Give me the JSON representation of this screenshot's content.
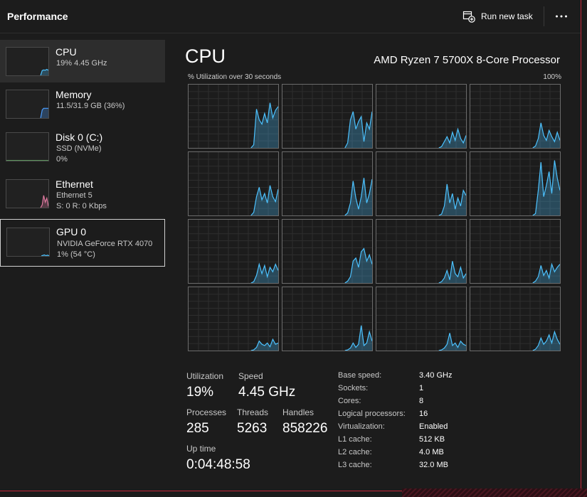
{
  "header": {
    "title": "Performance",
    "run_new_task": "Run new task",
    "run_icon": "run-task-icon",
    "more_icon": "more-options-icon"
  },
  "sidebar": {
    "items": [
      {
        "name": "CPU",
        "line1": "19%  4.45 GHz",
        "line2": "",
        "active": true,
        "color": "#4cc2ff"
      },
      {
        "name": "Memory",
        "line1": "11.5/31.9 GB (36%)",
        "line2": "",
        "active": false,
        "color": "#4a9eff"
      },
      {
        "name": "Disk 0 (C:)",
        "line1": "SSD (NVMe)",
        "line2": "0%",
        "active": false,
        "color": "#7fd87f"
      },
      {
        "name": "Ethernet",
        "line1": "Ethernet 5",
        "line2": "S: 0  R: 0 Kbps",
        "active": false,
        "color": "#e07aa0"
      },
      {
        "name": "GPU 0",
        "line1": "NVIDIA GeForce RTX 4070",
        "line2": "1%  (54 °C)",
        "active": false,
        "color": "#4cc2ff"
      }
    ]
  },
  "main": {
    "title": "CPU",
    "model": "AMD Ryzen 7 5700X 8-Core Processor",
    "graph_caption": "% Utilization over 30 seconds",
    "graph_max": "100%",
    "graph_color": "#4cc2ff",
    "stats": {
      "utilization_label": "Utilization",
      "utilization_value": "19%",
      "speed_label": "Speed",
      "speed_value": "4.45 GHz",
      "processes_label": "Processes",
      "processes_value": "285",
      "threads_label": "Threads",
      "threads_value": "5263",
      "handles_label": "Handles",
      "handles_value": "858226",
      "uptime_label": "Up time",
      "uptime_value": "0:04:48:58"
    },
    "specs": [
      {
        "label": "Base speed:",
        "value": "3.40 GHz"
      },
      {
        "label": "Sockets:",
        "value": "1"
      },
      {
        "label": "Cores:",
        "value": "8"
      },
      {
        "label": "Logical processors:",
        "value": "16"
      },
      {
        "label": "Virtualization:",
        "value": "Enabled"
      },
      {
        "label": "L1 cache:",
        "value": "512 KB"
      },
      {
        "label": "L2 cache:",
        "value": "4.0 MB"
      },
      {
        "label": "L3 cache:",
        "value": "32.0 MB"
      }
    ]
  },
  "chart_data": {
    "type": "area",
    "ylim": [
      0,
      100
    ],
    "grid": true,
    "series": [
      {
        "values": [
          0,
          0,
          0,
          0,
          0,
          0,
          0,
          0,
          0,
          0,
          0,
          0,
          0,
          0,
          0,
          0,
          0,
          0,
          0,
          0,
          0,
          0,
          0,
          0,
          5,
          62,
          45,
          38,
          55,
          40,
          72,
          48,
          60,
          66
        ]
      },
      {
        "values": [
          0,
          0,
          0,
          0,
          0,
          0,
          0,
          0,
          0,
          0,
          0,
          0,
          0,
          0,
          0,
          0,
          0,
          0,
          0,
          0,
          0,
          0,
          0,
          0,
          8,
          45,
          58,
          30,
          42,
          50,
          10,
          40,
          30,
          58
        ]
      },
      {
        "values": [
          0,
          0,
          0,
          0,
          0,
          0,
          0,
          0,
          0,
          0,
          0,
          0,
          0,
          0,
          0,
          0,
          0,
          0,
          0,
          0,
          0,
          0,
          0,
          0,
          2,
          10,
          18,
          8,
          25,
          12,
          30,
          15,
          8,
          20
        ]
      },
      {
        "values": [
          0,
          0,
          0,
          0,
          0,
          0,
          0,
          0,
          0,
          0,
          0,
          0,
          0,
          0,
          0,
          0,
          0,
          0,
          0,
          0,
          0,
          0,
          0,
          0,
          3,
          15,
          40,
          20,
          12,
          28,
          18,
          10,
          25,
          12
        ]
      },
      {
        "values": [
          0,
          0,
          0,
          0,
          0,
          0,
          0,
          0,
          0,
          0,
          0,
          0,
          0,
          0,
          0,
          0,
          0,
          0,
          0,
          0,
          0,
          0,
          0,
          0,
          5,
          30,
          45,
          25,
          35,
          20,
          48,
          30,
          22,
          42
        ]
      },
      {
        "values": [
          0,
          0,
          0,
          0,
          0,
          0,
          0,
          0,
          0,
          0,
          0,
          0,
          0,
          0,
          0,
          0,
          0,
          0,
          0,
          0,
          0,
          0,
          0,
          0,
          4,
          20,
          55,
          28,
          10,
          30,
          60,
          20,
          35,
          58
        ]
      },
      {
        "values": [
          0,
          0,
          0,
          0,
          0,
          0,
          0,
          0,
          0,
          0,
          0,
          0,
          0,
          0,
          0,
          0,
          0,
          0,
          0,
          0,
          0,
          0,
          0,
          0,
          2,
          15,
          50,
          20,
          35,
          10,
          28,
          15,
          40,
          32
        ]
      },
      {
        "values": [
          0,
          0,
          0,
          0,
          0,
          0,
          0,
          0,
          0,
          0,
          0,
          0,
          0,
          0,
          0,
          0,
          0,
          0,
          0,
          0,
          0,
          0,
          0,
          0,
          3,
          40,
          85,
          30,
          48,
          70,
          35,
          88,
          60,
          40
        ]
      },
      {
        "values": [
          0,
          0,
          0,
          0,
          0,
          0,
          0,
          0,
          0,
          0,
          0,
          0,
          0,
          0,
          0,
          0,
          0,
          0,
          0,
          0,
          0,
          0,
          0,
          0,
          2,
          12,
          30,
          15,
          28,
          10,
          25,
          18,
          30,
          20
        ]
      },
      {
        "values": [
          0,
          0,
          0,
          0,
          0,
          0,
          0,
          0,
          0,
          0,
          0,
          0,
          0,
          0,
          0,
          0,
          0,
          0,
          0,
          0,
          0,
          0,
          0,
          0,
          3,
          10,
          35,
          40,
          25,
          50,
          55,
          35,
          45,
          30
        ]
      },
      {
        "values": [
          0,
          0,
          0,
          0,
          0,
          0,
          0,
          0,
          0,
          0,
          0,
          0,
          0,
          0,
          0,
          0,
          0,
          0,
          0,
          0,
          0,
          0,
          0,
          0,
          2,
          8,
          20,
          5,
          35,
          15,
          10,
          25,
          8,
          15
        ]
      },
      {
        "values": [
          0,
          0,
          0,
          0,
          0,
          0,
          0,
          0,
          0,
          0,
          0,
          0,
          0,
          0,
          0,
          0,
          0,
          0,
          0,
          0,
          0,
          0,
          0,
          0,
          3,
          10,
          28,
          12,
          20,
          8,
          30,
          18,
          25,
          30
        ]
      },
      {
        "values": [
          0,
          0,
          0,
          0,
          0,
          0,
          0,
          0,
          0,
          0,
          0,
          0,
          0,
          0,
          0,
          0,
          0,
          0,
          0,
          0,
          0,
          0,
          0,
          0,
          1,
          5,
          15,
          10,
          8,
          12,
          6,
          18,
          10,
          12
        ]
      },
      {
        "values": [
          0,
          0,
          0,
          0,
          0,
          0,
          0,
          0,
          0,
          0,
          0,
          0,
          0,
          0,
          0,
          0,
          0,
          0,
          0,
          0,
          0,
          0,
          0,
          0,
          1,
          4,
          12,
          5,
          10,
          40,
          8,
          12,
          30,
          15
        ]
      },
      {
        "values": [
          0,
          0,
          0,
          0,
          0,
          0,
          0,
          0,
          0,
          0,
          0,
          0,
          0,
          0,
          0,
          0,
          0,
          0,
          0,
          0,
          0,
          0,
          0,
          0,
          1,
          4,
          10,
          28,
          8,
          12,
          5,
          15,
          10,
          8
        ]
      },
      {
        "values": [
          0,
          0,
          0,
          0,
          0,
          0,
          0,
          0,
          0,
          0,
          0,
          0,
          0,
          0,
          0,
          0,
          0,
          0,
          0,
          0,
          0,
          0,
          0,
          0,
          2,
          8,
          20,
          10,
          15,
          25,
          12,
          30,
          18,
          10
        ]
      }
    ]
  },
  "sidebar_sparklines": {
    "cpu": [
      0,
      0,
      0,
      0,
      0,
      0,
      0,
      0,
      0,
      0,
      0,
      0,
      0,
      0,
      0,
      0,
      0,
      0,
      0,
      0,
      0,
      0,
      0,
      18,
      20,
      19,
      22,
      19
    ],
    "memory": [
      0,
      0,
      0,
      0,
      0,
      0,
      0,
      0,
      0,
      0,
      0,
      0,
      0,
      0,
      0,
      0,
      0,
      0,
      0,
      0,
      0,
      0,
      0,
      30,
      36,
      36,
      36,
      36
    ],
    "disk": [
      0,
      0,
      0,
      0,
      0,
      0,
      0,
      0,
      0,
      0,
      0,
      0,
      0,
      0,
      0,
      0,
      0,
      0,
      0,
      0,
      0,
      0,
      0,
      0,
      0,
      0,
      0,
      0
    ],
    "ethernet": [
      0,
      0,
      0,
      0,
      0,
      0,
      0,
      0,
      0,
      0,
      0,
      0,
      0,
      0,
      0,
      0,
      0,
      0,
      0,
      0,
      0,
      0,
      0,
      10,
      45,
      20,
      35,
      5
    ],
    "gpu": [
      0,
      0,
      0,
      0,
      0,
      0,
      0,
      0,
      0,
      0,
      0,
      0,
      0,
      0,
      0,
      0,
      0,
      0,
      0,
      0,
      0,
      0,
      0,
      2,
      4,
      1,
      3,
      1
    ]
  }
}
